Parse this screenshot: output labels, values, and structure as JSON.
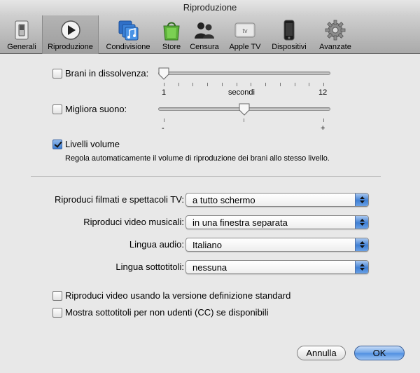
{
  "window": {
    "title": "Riproduzione"
  },
  "toolbar": {
    "items": [
      {
        "label": "Generali",
        "icon": "switch-icon"
      },
      {
        "label": "Riproduzione",
        "icon": "play-icon"
      },
      {
        "label": "Condivisione",
        "icon": "music-sharing-icon"
      },
      {
        "label": "Store",
        "icon": "shopping-bag-icon"
      },
      {
        "label": "Censura",
        "icon": "parental-icon"
      },
      {
        "label": "Apple TV",
        "icon": "appletv-icon",
        "icon_text": "tv"
      },
      {
        "label": "Dispositivi",
        "icon": "iphone-icon"
      },
      {
        "label": "Avanzate",
        "icon": "gear-icon"
      }
    ],
    "selected": "Riproduzione"
  },
  "crossfade": {
    "label": "Brani in dissolvenza:",
    "checked": false,
    "min_label": "1",
    "unit_label": "secondi",
    "max_label": "12",
    "value": 1
  },
  "sound_enhancer": {
    "label": "Migliora suono:",
    "checked": false,
    "min_label": "-",
    "max_label": "+",
    "level": 0.5
  },
  "sound_check": {
    "label": "Livelli volume",
    "checked": true,
    "description": "Regola automaticamente il volume di riproduzione dei brani allo stesso livello."
  },
  "popups": {
    "movies": {
      "label": "Riproduci filmati e spettacoli TV:",
      "value": "a tutto schermo"
    },
    "music_videos": {
      "label": "Riproduci video musicali:",
      "value": "in una finestra separata"
    },
    "audio_language": {
      "label": "Lingua audio:",
      "value": "Italiano"
    },
    "subtitle_language": {
      "label": "Lingua sottotitoli:",
      "value": "nessuna"
    }
  },
  "options": {
    "standard_definition": {
      "label": "Riproduci video usando la versione definizione standard",
      "checked": false
    },
    "closed_captions": {
      "label": "Mostra sottotitoli per non udenti (CC) se disponibili",
      "checked": false
    }
  },
  "buttons": {
    "cancel": "Annulla",
    "ok": "OK"
  },
  "colors": {
    "accent": "#3e7fd3",
    "selected_tab": "#a8a8a8"
  }
}
